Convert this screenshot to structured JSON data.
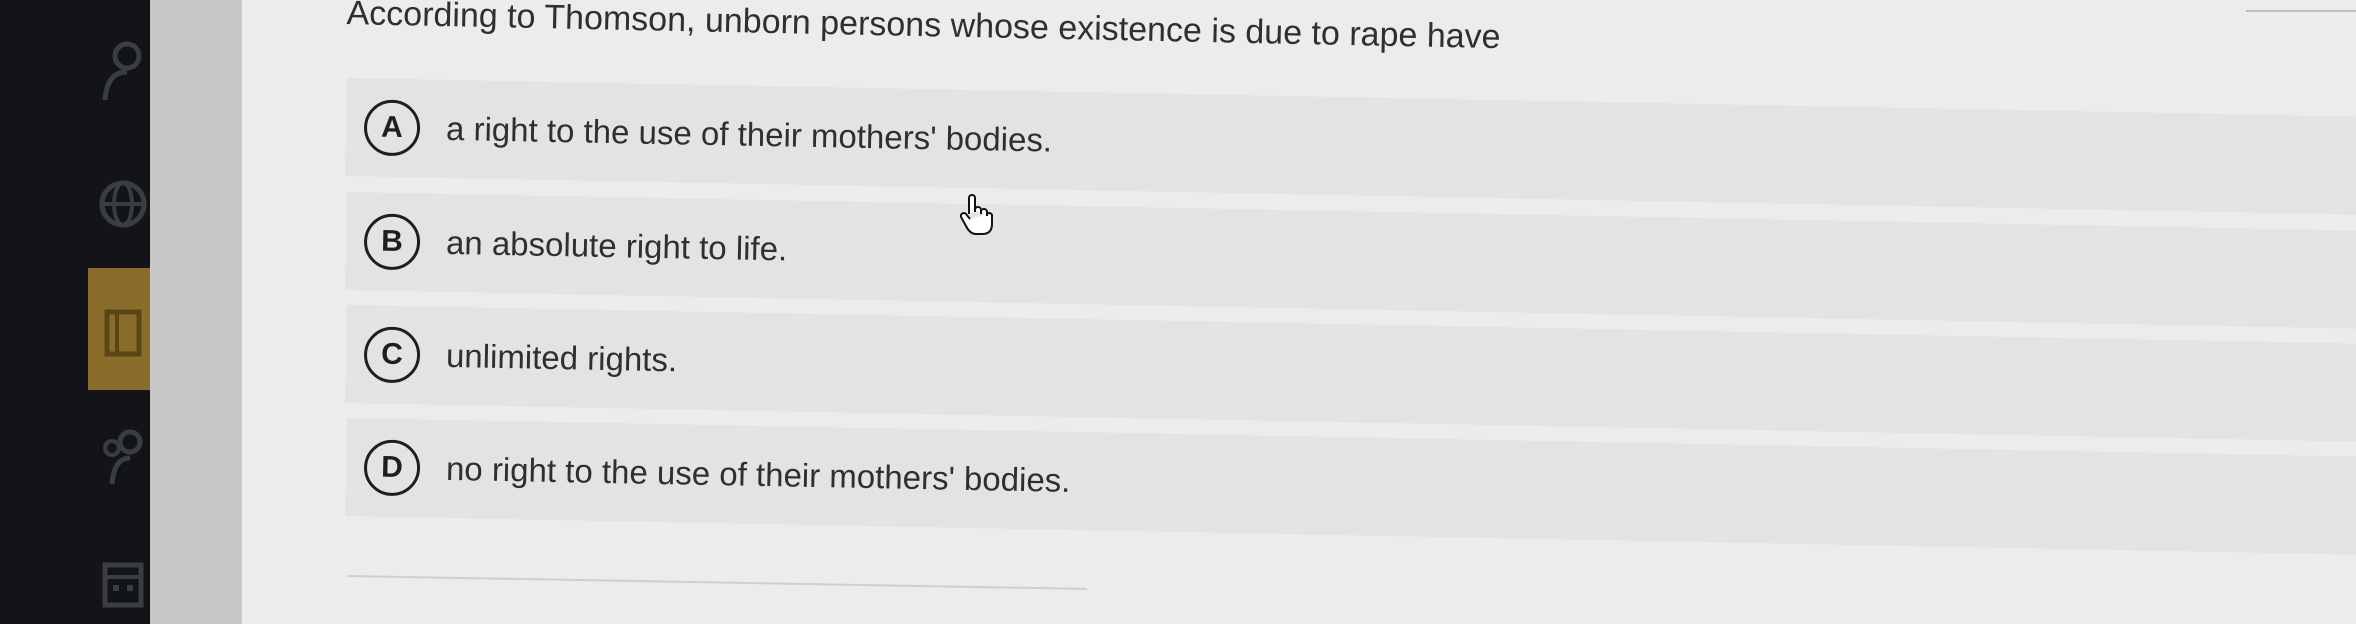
{
  "question": {
    "text": "According to Thomson, unborn persons whose existence is due to rape have"
  },
  "options": [
    {
      "letter": "A",
      "text": "a right to the use of their mothers' bodies."
    },
    {
      "letter": "B",
      "text": "an absolute right to life."
    },
    {
      "letter": "C",
      "text": "unlimited rights."
    },
    {
      "letter": "D",
      "text": "no right to the use of their mothers' bodies."
    }
  ],
  "sidebar": {
    "icons": [
      "person-icon",
      "globe-icon",
      "book-icon",
      "people-icon",
      "calendar-icon"
    ],
    "active_color": "#8a6d2a"
  },
  "colors": {
    "sidebar_bg": "#121417",
    "content_bg": "#ececec",
    "option_bg": "#e3e3e3"
  }
}
